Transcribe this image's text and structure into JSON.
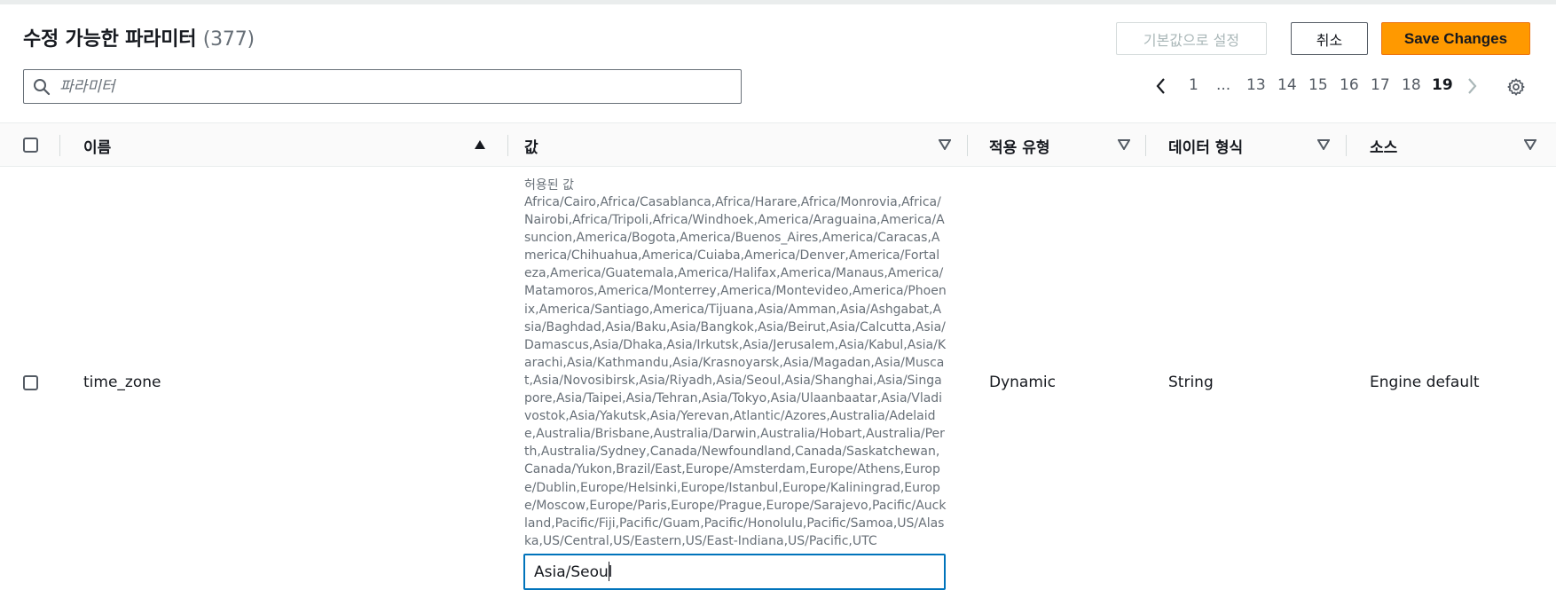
{
  "header": {
    "title": "수정 가능한 파라미터",
    "count": "(377)"
  },
  "toolbar": {
    "reset_label": "기본값으로 설정",
    "cancel_label": "취소",
    "save_label": "Save Changes"
  },
  "search": {
    "placeholder": "파라미터",
    "value": ""
  },
  "pagination": {
    "pages": [
      "1",
      "...",
      "13",
      "14",
      "15",
      "16",
      "17",
      "18",
      "19"
    ],
    "current": "19"
  },
  "columns": {
    "name": "이름",
    "value": "값",
    "apply_type": "적용 유형",
    "data_type": "데이터 형식",
    "source": "소스"
  },
  "row": {
    "name": "time_zone",
    "allowed_label": "허용된 값",
    "allowed_values": "Africa/Cairo,Africa/Casablanca,Africa/Harare,Africa/Monrovia,Africa/Nairobi,Africa/Tripoli,Africa/Windhoek,America/Araguaina,America/Asuncion,America/Bogota,America/Buenos_Aires,America/Caracas,America/Chihuahua,America/Cuiaba,America/Denver,America/Fortaleza,America/Guatemala,America/Halifax,America/Manaus,America/Matamoros,America/Monterrey,America/Montevideo,America/Phoenix,America/Santiago,America/Tijuana,Asia/Amman,Asia/Ashgabat,Asia/Baghdad,Asia/Baku,Asia/Bangkok,Asia/Beirut,Asia/Calcutta,Asia/Damascus,Asia/Dhaka,Asia/Irkutsk,Asia/Jerusalem,Asia/Kabul,Asia/Karachi,Asia/Kathmandu,Asia/Krasnoyarsk,Asia/Magadan,Asia/Muscat,Asia/Novosibirsk,Asia/Riyadh,Asia/Seoul,Asia/Shanghai,Asia/Singapore,Asia/Taipei,Asia/Tehran,Asia/Tokyo,Asia/Ulaanbaatar,Asia/Vladivostok,Asia/Yakutsk,Asia/Yerevan,Atlantic/Azores,Australia/Adelaide,Australia/Brisbane,Australia/Darwin,Australia/Hobart,Australia/Perth,Australia/Sydney,Canada/Newfoundland,Canada/Saskatchewan,Canada/Yukon,Brazil/East,Europe/Amsterdam,Europe/Athens,Europe/Dublin,Europe/Helsinki,Europe/Istanbul,Europe/Kaliningrad,Europe/Moscow,Europe/Paris,Europe/Prague,Europe/Sarajevo,Pacific/Auckland,Pacific/Fiji,Pacific/Guam,Pacific/Honolulu,Pacific/Samoa,US/Alaska,US/Central,US/Eastern,US/East-Indiana,US/Pacific,UTC",
    "value": "Asia/Seoul",
    "apply_type": "Dynamic",
    "data_type": "String",
    "source": "Engine default"
  },
  "colors": {
    "primary": "#ff9900",
    "focus": "#0073bb",
    "text": "#16191f",
    "muted": "#687078"
  }
}
